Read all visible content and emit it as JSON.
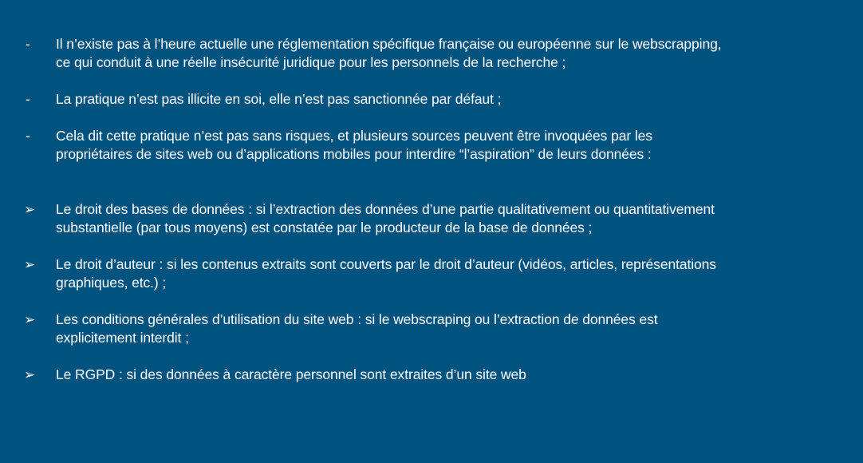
{
  "bullets": [
    {
      "marker": "-",
      "lines": [
        "Il n’existe pas à l’heure actuelle une réglementation spécifique française ou européenne sur le webscrapping,",
        "ce qui conduit à une réelle insécurité juridique pour les personnels de la recherche ;"
      ]
    },
    {
      "marker": "-",
      "lines": [
        "La pratique n’est pas illicite en soi, elle n’est pas sanctionnée par défaut ;"
      ]
    },
    {
      "marker": "-",
      "lines": [
        "Cela dit cette pratique n’est pas sans risques, et plusieurs sources peuvent être invoquées par les",
        "propriétaires de sites web ou d’applications mobiles pour interdire “l’aspiration” de leurs données :"
      ]
    }
  ],
  "arrows": [
    {
      "marker": "➢",
      "lines": [
        "Le droit des bases de données : si l’extraction des données d’une partie qualitativement ou quantitativement",
        "substantielle (par tous moyens) est constatée par le producteur de la base de données ;"
      ]
    },
    {
      "marker": "➢",
      "lines": [
        "Le droit d’auteur : si les contenus extraits sont couverts par le droit d’auteur (vidéos, articles, représentations",
        "graphiques, etc.) ;"
      ]
    },
    {
      "marker": "➢",
      "lines": [
        "Les conditions générales d’utilisation du site web : si le webscraping ou l’extraction de données est",
        "explicitement interdit ;"
      ]
    },
    {
      "marker": "➢",
      "lines": [
        "Le RGPD : si des données à caractère personnel sont extraites d’un site web"
      ]
    }
  ]
}
